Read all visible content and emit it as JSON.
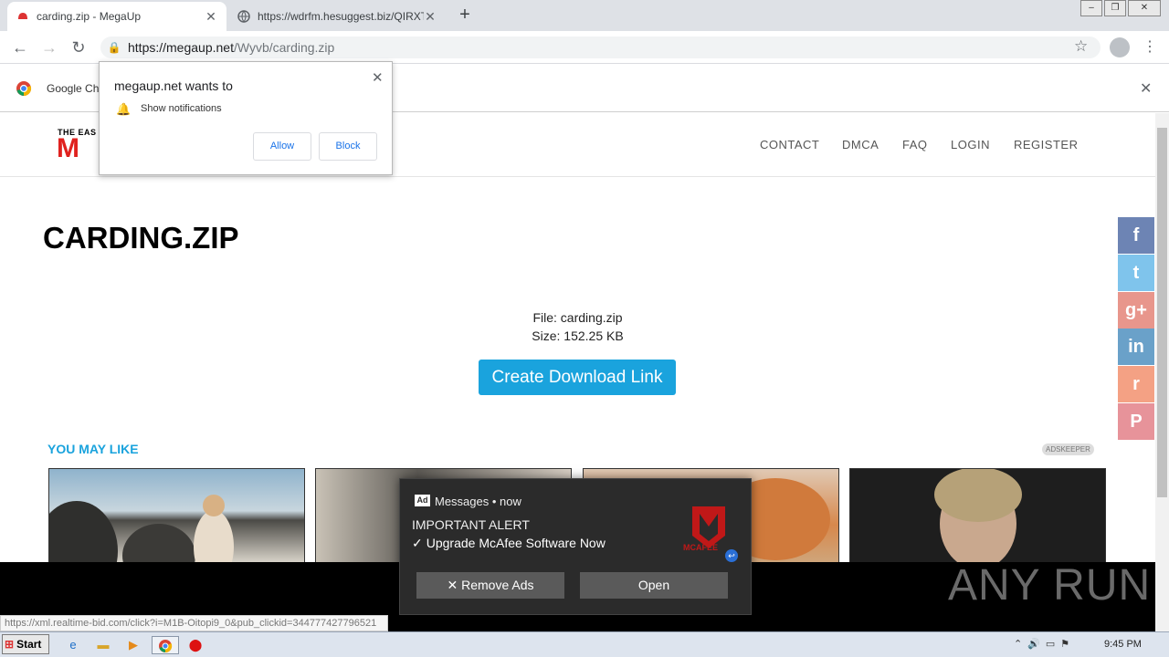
{
  "browser": {
    "tabs": [
      {
        "title": "carding.zip - MegaUp"
      },
      {
        "title": "https://wdrfm.hesuggest.biz/QIRXT"
      }
    ],
    "new_tab": "+",
    "url_host": "https://megaup.net",
    "url_path": "/Wyvb/carding.zip",
    "infobar_text": "Google Ch",
    "win_min": "‒",
    "win_max": "❐",
    "win_close": "✕"
  },
  "notification_prompt": {
    "title": "megaup.net wants to",
    "permission": "Show notifications",
    "allow_label": "Allow",
    "block_label": "Block"
  },
  "site": {
    "logo_tagline": "THE EAS",
    "logo_letter": "M",
    "nav": [
      "CONTACT",
      "DMCA",
      "FAQ",
      "LOGIN",
      "REGISTER"
    ],
    "page_title": "CARDING.ZIP",
    "file_line": "File: carding.zip",
    "size_line": "Size: 152.25 KB",
    "download_label": "Create Download Link",
    "you_may_like": "YOU MAY LIKE",
    "adskeeper": "ADSKEEPER",
    "social": [
      {
        "icon": "facebook-icon",
        "glyph": "f",
        "color": "#6d84b4"
      },
      {
        "icon": "twitter-icon",
        "glyph": "t",
        "color": "#7fc4ec"
      },
      {
        "icon": "googleplus-icon",
        "glyph": "g+",
        "color": "#e8968c"
      },
      {
        "icon": "linkedin-icon",
        "glyph": "in",
        "color": "#6aa1c9"
      },
      {
        "icon": "reddit-icon",
        "glyph": "r",
        "color": "#f4a184"
      },
      {
        "icon": "pinterest-icon",
        "glyph": "P",
        "color": "#e7939a"
      }
    ]
  },
  "status_url": "https://xml.realtime-bid.com/click?i=M1B-Oitopi9_0&pub_clickid=344777427796521",
  "toast": {
    "app": "Messages • now",
    "headline": "IMPORTANT ALERT",
    "message": "Upgrade McAfee Software Now",
    "brand": "MCAFEE",
    "remove_label": "Remove Ads",
    "open_label": "Open"
  },
  "watermark": "ANY RUN",
  "taskbar": {
    "start_label": "Start",
    "clock": "9:45 PM"
  }
}
